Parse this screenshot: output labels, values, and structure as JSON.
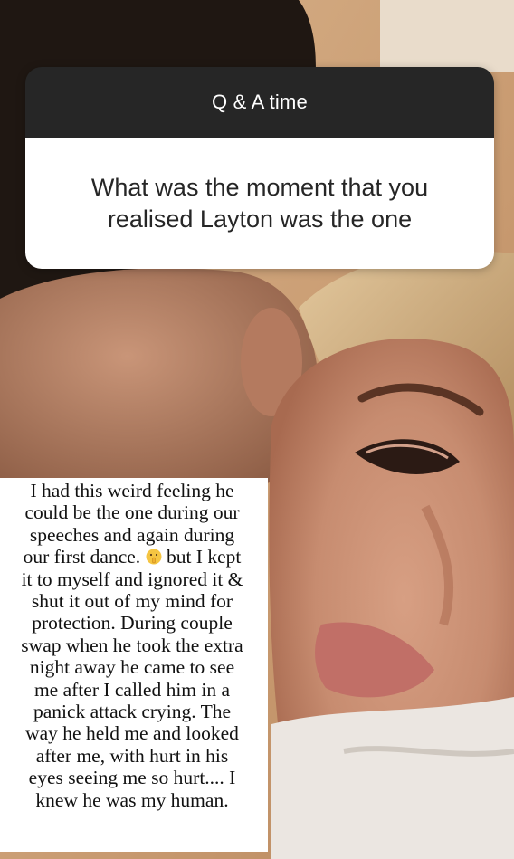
{
  "question_sticker": {
    "header": "Q & A time",
    "question": "What was the moment that you realised Layton was the one"
  },
  "answer": {
    "lines": [
      "I had this weird feeling he",
      "could be the one during our",
      "speeches and again during",
      "our first dance.",
      "but I kept",
      "it to myself and ignored it &",
      "shut it out of my mind for",
      "protection. During couple",
      "swap when he took the extra",
      "night away he came to see",
      "me after I called him in a",
      "panick attack crying. The",
      "way he held me and looked",
      "after me, with hurt in his",
      "eyes seeing me so hurt.... I",
      "knew he was my human."
    ],
    "emoji": "shushing-face-emoji"
  },
  "colors": {
    "sticker_header_bg": "#262626",
    "sticker_body_bg": "#ffffff",
    "answer_bg": "#ffffff"
  }
}
